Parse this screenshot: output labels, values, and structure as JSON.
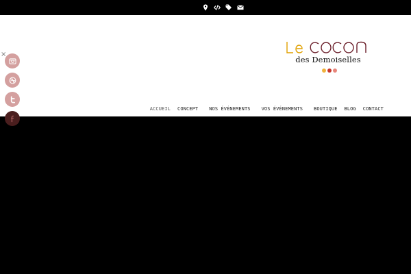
{
  "topbar": {
    "icons": [
      "map-pin-icon",
      "code-icon",
      "tag-icon",
      "envelope-icon"
    ]
  },
  "header": {
    "close_label": "×",
    "logo": {
      "title": "Le Cocon",
      "subtitle": "des Demoiselles",
      "dot_colors": [
        "#f0b23c",
        "#c8392e",
        "#e8857a"
      ],
      "title_colors": {
        "le": "#e0a000",
        "cocon": "#6b1f2a"
      }
    }
  },
  "nav": {
    "items": [
      {
        "label": "ACCUEIL"
      },
      {
        "label": "CONCEPT"
      },
      {
        "label": "NOS ÉVÉNEMENTS"
      },
      {
        "label": "VOS ÉVÉNEMENTS"
      },
      {
        "label": "BOUTIQUE"
      },
      {
        "label": "BLOG"
      },
      {
        "label": "CONTACT"
      }
    ]
  },
  "social": {
    "icons": [
      "instagram-icon",
      "dribbble-icon",
      "twitter-icon",
      "facebook-icon"
    ]
  },
  "colors": {
    "topbar_bg": "#000000",
    "header_bg": "#ffffff",
    "social_bg": "#d4a09f",
    "content_bg": "#000000"
  }
}
